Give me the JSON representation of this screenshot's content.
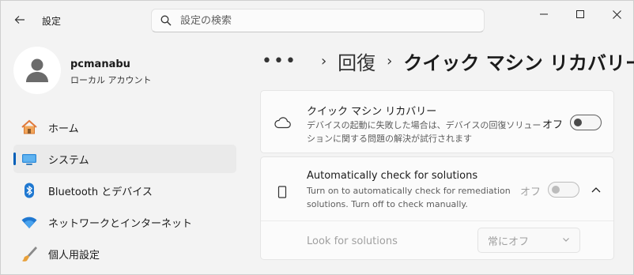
{
  "titlebar": {
    "app_title": "設定",
    "search_placeholder": "設定の検索"
  },
  "profile": {
    "name": "pcmanabu",
    "account_type": "ローカル アカウント"
  },
  "sidebar": {
    "items": [
      {
        "label": "ホーム",
        "icon": "home-icon"
      },
      {
        "label": "システム",
        "icon": "system-monitor-icon",
        "active": true
      },
      {
        "label": "Bluetooth とデバイス",
        "icon": "bluetooth-icon"
      },
      {
        "label": "ネットワークとインターネット",
        "icon": "wifi-icon"
      },
      {
        "label": "個人用設定",
        "icon": "brush-icon"
      }
    ]
  },
  "breadcrumb": {
    "more": "•••",
    "parent": "回復",
    "current": "クイック マシン リカバリー"
  },
  "cards": {
    "qmr": {
      "title": "クイック マシン リカバリー",
      "description_line1": "デバイスの起動に失敗した場合は、デバイスの回復ソリュー",
      "description_line2": "ションに関する問題の解決が試行されます",
      "toggle_label": "オフ",
      "toggle_on": false,
      "icon": "cloud-icon"
    },
    "auto_check": {
      "title": "Automatically check for solutions",
      "description_line1": "Turn on to automatically check for remediation",
      "description_line2": "solutions. Turn off to check manually.",
      "toggle_label": "オフ",
      "toggle_on": false,
      "icon": "phone-device-icon",
      "sub_label": "Look for solutions",
      "dropdown_value": "常にオフ"
    }
  },
  "colors": {
    "accent": "#005fb8",
    "background": "#f3f3f3",
    "card": "#fbfbfb"
  }
}
